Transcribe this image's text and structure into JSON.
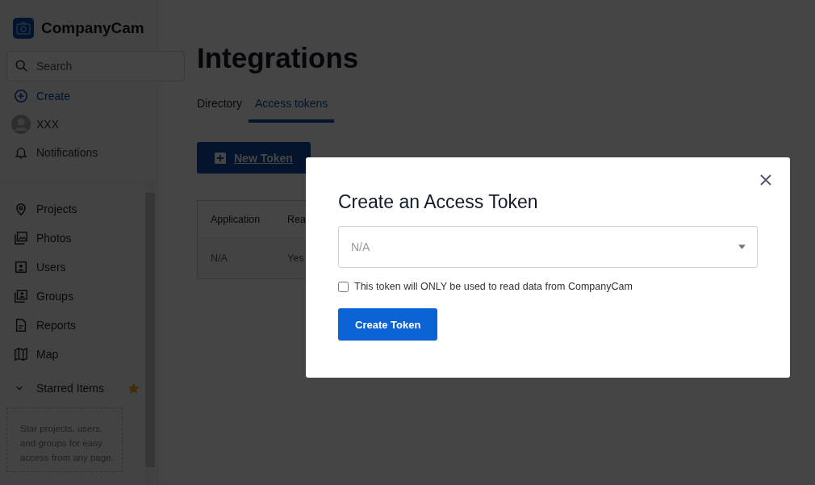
{
  "sidebar": {
    "logo": "CompanyCam",
    "search": {
      "placeholder": "Search"
    },
    "top_items": [
      {
        "kind": "create",
        "label": "Create"
      },
      {
        "kind": "avatar",
        "label": "XXX"
      },
      {
        "kind": "bell",
        "label": "Notifications"
      }
    ],
    "nav_items": [
      {
        "kind": "pin",
        "label": "Projects"
      },
      {
        "kind": "photos",
        "label": "Photos"
      },
      {
        "kind": "user",
        "label": "Users"
      },
      {
        "kind": "groups",
        "label": "Groups"
      },
      {
        "kind": "report",
        "label": "Reports"
      },
      {
        "kind": "map",
        "label": "Map"
      }
    ],
    "starred": {
      "label": "Starred Items",
      "expanded": true,
      "hint": "Star projects, users, and groups for easy access from any page."
    }
  },
  "page": {
    "title": "Integrations",
    "tabs": [
      {
        "label": "Directory",
        "selected": false
      },
      {
        "label": "Access tokens",
        "selected": true
      }
    ],
    "new_button": "New Token",
    "table": {
      "columns": [
        "Application",
        "Rea"
      ],
      "rows": [
        [
          "N/A",
          "Yes"
        ]
      ]
    }
  },
  "dialog": {
    "title": "Create an Access Token",
    "select": {
      "placeholder": "N/A"
    },
    "checkbox": {
      "label": "This token will ONLY be used to read data from CompanyCam",
      "checked": false
    },
    "button": "Create Token"
  }
}
